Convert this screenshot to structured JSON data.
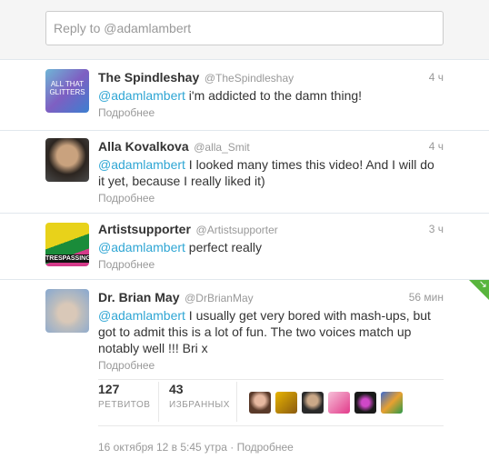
{
  "reply": {
    "placeholder": "Reply to @adamlambert"
  },
  "tweets": [
    {
      "fullname": "The Spindleshay",
      "username": "@TheSpindleshay",
      "time": "4 ч",
      "mention": "@adamlambert",
      "text": " i'm addicted to the damn thing!",
      "more": "Подробнее",
      "avatar_text": "ALL THAT GLITTERS"
    },
    {
      "fullname": "Alla Kovalkova",
      "username": "@alla_Smit",
      "time": "4 ч",
      "mention": "@adamlambert",
      "text": " I looked many times this video! And I will do it yet, because I really liked it)",
      "more": "Подробнее"
    },
    {
      "fullname": "Artistsupporter",
      "username": "@Artistsupporter",
      "time": "3 ч",
      "mention": "@adamlambert",
      "text": " perfect really",
      "more": "Подробнее",
      "avatar_text": "TRESPASSING"
    },
    {
      "fullname": "Dr. Brian May",
      "username": "@DrBrianMay",
      "time": "56 мин",
      "mention": "@adamlambert",
      "text": " I usually get very bored with mash-ups, but got to admit this is a lot of fun. The two voices match up notably well !!! Bri x",
      "more": "Подробнее"
    }
  ],
  "stats": {
    "retweets_count": "127",
    "retweets_label": "РЕТВИТОВ",
    "favorites_count": "43",
    "favorites_label": "ИЗБРАННЫХ"
  },
  "footer": {
    "timestamp": "16 октября 12 в 5:45 утра",
    "separator": " · ",
    "details": "Подробнее"
  },
  "colors": {
    "mention": "#2fa6d4",
    "corner": "#59b53d"
  }
}
